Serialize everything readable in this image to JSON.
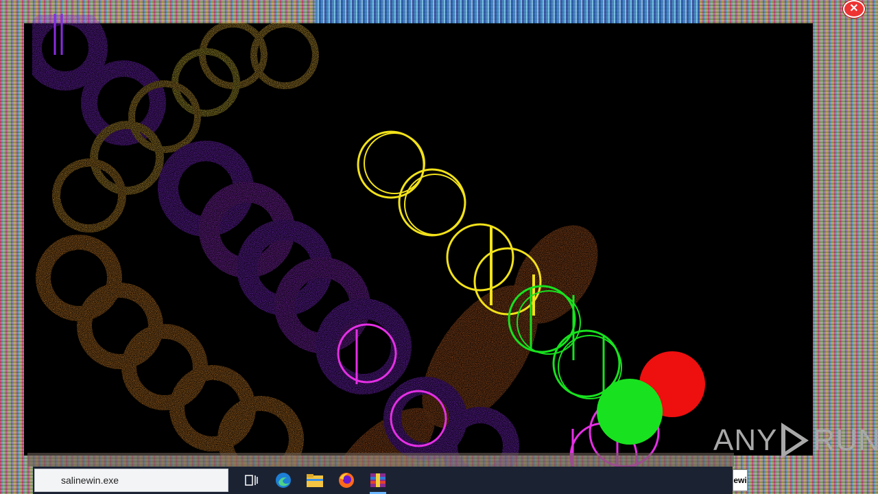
{
  "window": {
    "close_glyph": "✕"
  },
  "watermark": {
    "text_left": "ANY",
    "text_right": "RUN"
  },
  "taskbar": {
    "search_value": "salinewin.exe",
    "icons": [
      {
        "name": "task-view-icon"
      },
      {
        "name": "edge-icon"
      },
      {
        "name": "file-explorer-icon"
      },
      {
        "name": "firefox-icon"
      },
      {
        "name": "winrar-icon",
        "active": true
      }
    ],
    "tray_fragment": "ewi"
  },
  "colors": {
    "purple": "#8a2be2",
    "magenta": "#d21fd2",
    "orange": "#e08a2c",
    "gold": "#e3b23c",
    "yellow": "#f2e21a",
    "green": "#18e21f",
    "red": "#ee0f0f",
    "taskbar": "#1b2333"
  }
}
